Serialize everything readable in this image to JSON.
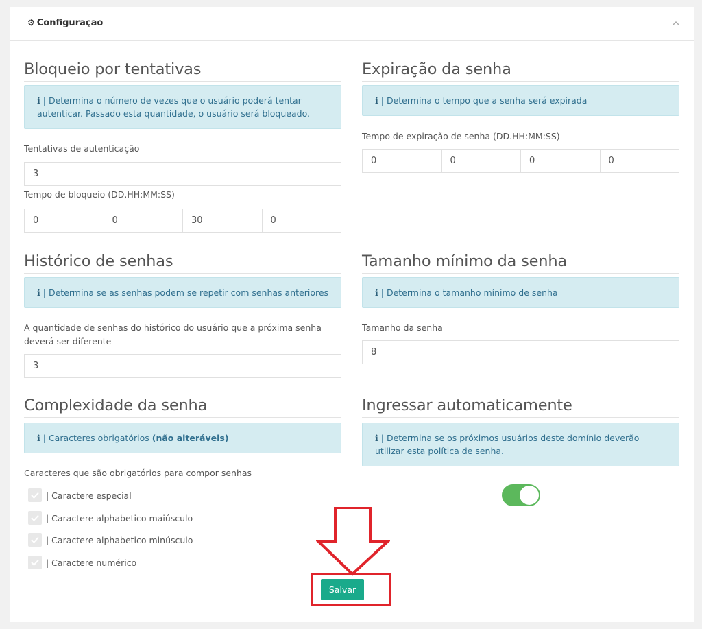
{
  "header": {
    "title": "Configuração",
    "gear_icon": "gear-icon",
    "collapse_icon": "chevron-up-icon"
  },
  "lockout": {
    "title": "Bloqueio por tentativas",
    "info": "Determina o número de vezes que o usuário poderá tentar autenticar. Passado esta quantidade, o usuário será bloqueado.",
    "attempts_label": "Tentativas de autenticação",
    "attempts_value": "3",
    "duration_label": "Tempo de bloqueio (DD.HH:MM:SS)",
    "duration": [
      "0",
      "0",
      "30",
      "0"
    ]
  },
  "expiration": {
    "title": "Expiração da senha",
    "info": "Determina o tempo que a senha será expirada",
    "duration_label": "Tempo de expiração de senha (DD.HH:MM:SS)",
    "duration": [
      "0",
      "0",
      "0",
      "0"
    ]
  },
  "history": {
    "title": "Histórico de senhas",
    "info": "Determina se as senhas podem se repetir com senhas anteriores",
    "label": "A quantidade de senhas do histórico do usuário que a próxima senha deverá ser diferente",
    "value": "3"
  },
  "min_length": {
    "title": "Tamanho mínimo da senha",
    "info": "Determina o tamanho mínimo de senha",
    "label": "Tamanho da senha",
    "value": "8"
  },
  "complexity": {
    "title": "Complexidade da senha",
    "info_prefix": "Caracteres obrigatórios",
    "info_bold": "(não alteráveis)",
    "label": "Caracteres que são obrigatórios para compor senhas",
    "items": [
      "| Caractere especial",
      "| Caractere alphabetico maiúsculo",
      "| Caractere alphabetico minúsculo",
      "| Caractere numérico"
    ]
  },
  "auto_join": {
    "title": "Ingressar automaticamente",
    "info": "Determina se os próximos usuários deste domínio deverão utilizar esta política de senha.",
    "enabled": true
  },
  "info_separator": "|",
  "save_label": "Salvar",
  "colors": {
    "accent": "#1aaa8b",
    "toggle_on": "#5cb85c",
    "annotation": "#e0242b",
    "info_bg": "#d5ecf1"
  }
}
